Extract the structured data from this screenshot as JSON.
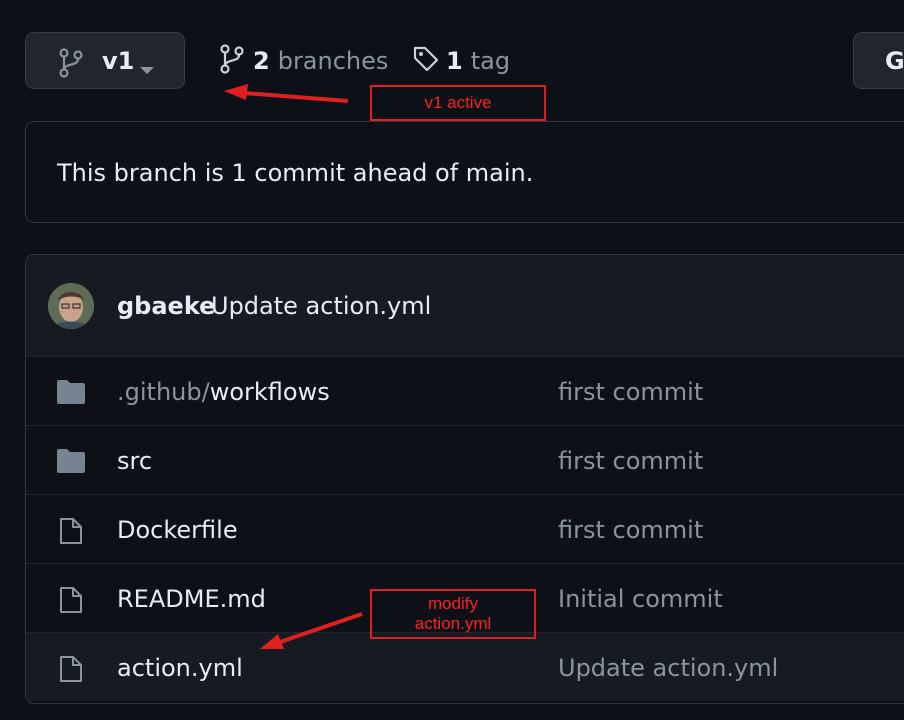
{
  "toolbar": {
    "branch_label": "v1",
    "branches_count": "2",
    "branches_word": "branches",
    "tags_count": "1",
    "tags_word": "tag",
    "go_to_file_partial": "G"
  },
  "status": {
    "ahead_text": "This branch is 1 commit ahead of main."
  },
  "latest_commit": {
    "author": "gbaeke",
    "message": "Update action.yml"
  },
  "files": [
    {
      "icon": "folder-icon",
      "prefix": ".github/",
      "name": "workflows",
      "message": "first commit"
    },
    {
      "icon": "folder-icon",
      "prefix": "",
      "name": "src",
      "message": "first commit"
    },
    {
      "icon": "file-icon",
      "prefix": "",
      "name": "Dockerfile",
      "message": "first commit"
    },
    {
      "icon": "file-icon",
      "prefix": "",
      "name": "README.md",
      "message": "Initial commit"
    },
    {
      "icon": "file-icon",
      "prefix": "",
      "name": "action.yml",
      "message": "Update action.yml"
    }
  ],
  "annotations": {
    "v1_note": "v1 active",
    "modify_line1": "modify",
    "modify_line2": "action.yml"
  },
  "colors": {
    "background": "#0d1117",
    "border": "#30363d",
    "text": "#e6edf3",
    "muted": "#8b949e",
    "annotation": "#e02020"
  }
}
